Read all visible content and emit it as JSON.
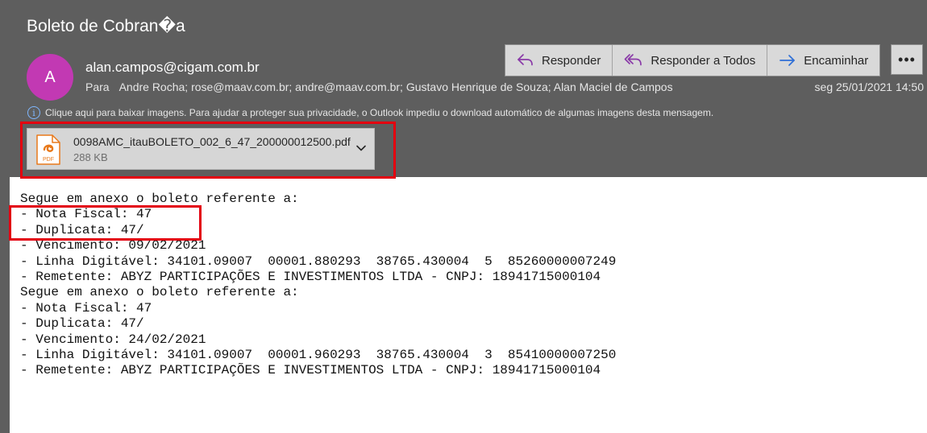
{
  "email": {
    "subject": "Boleto de Cobran�a",
    "avatar_initial": "A",
    "sender": "alan.campos@cigam.com.br",
    "to_label": "Para",
    "recipients": "Andre Rocha; rose@maav.com.br; andre@maav.com.br; Gustavo Henrique de Souza; Alan Maciel de Campos",
    "date": "seg 25/01/2021 14:50",
    "info_message": "Clique aqui para baixar imagens. Para ajudar a proteger sua privacidade, o Outlook impediu o download automático de algumas imagens desta mensagem."
  },
  "actions": {
    "reply": "Responder",
    "reply_all": "Responder a Todos",
    "forward": "Encaminhar",
    "more": "•••"
  },
  "attachment": {
    "filename": "0098AMC_itauBOLETO_002_6_47_200000012500.pdf",
    "size": "288 KB",
    "type_label": "PDF",
    "icon": "pdf-file-icon"
  },
  "body_lines": [
    "Segue em anexo o boleto referente a:",
    "- Nota Fiscal: 47",
    "- Duplicata: 47/",
    "- Vencimento: 09/02/2021",
    "- Linha Digitável: 34101.09007  00001.880293  38765.430004  5  85260000007249",
    "- Remetente: ABYZ PARTICIPAÇÕES E INVESTIMENTOS LTDA - CNPJ: 18941715000104",
    "Segue em anexo o boleto referente a:",
    "- Nota Fiscal: 47",
    "- Duplicata: 47/",
    "- Vencimento: 24/02/2021",
    "- Linha Digitável: 34101.09007  00001.960293  38765.430004  3  85410000007250",
    "- Remetente: ABYZ PARTICIPAÇÕES E INVESTIMENTOS LTDA - CNPJ: 18941715000104"
  ],
  "colors": {
    "header_bg": "#5e5e5e",
    "avatar_bg": "#c239b3",
    "reply_icon": "#8a3aa8",
    "forward_icon": "#2f6fd6",
    "highlight": "#e3000f",
    "pdf_orange": "#e8791a"
  }
}
